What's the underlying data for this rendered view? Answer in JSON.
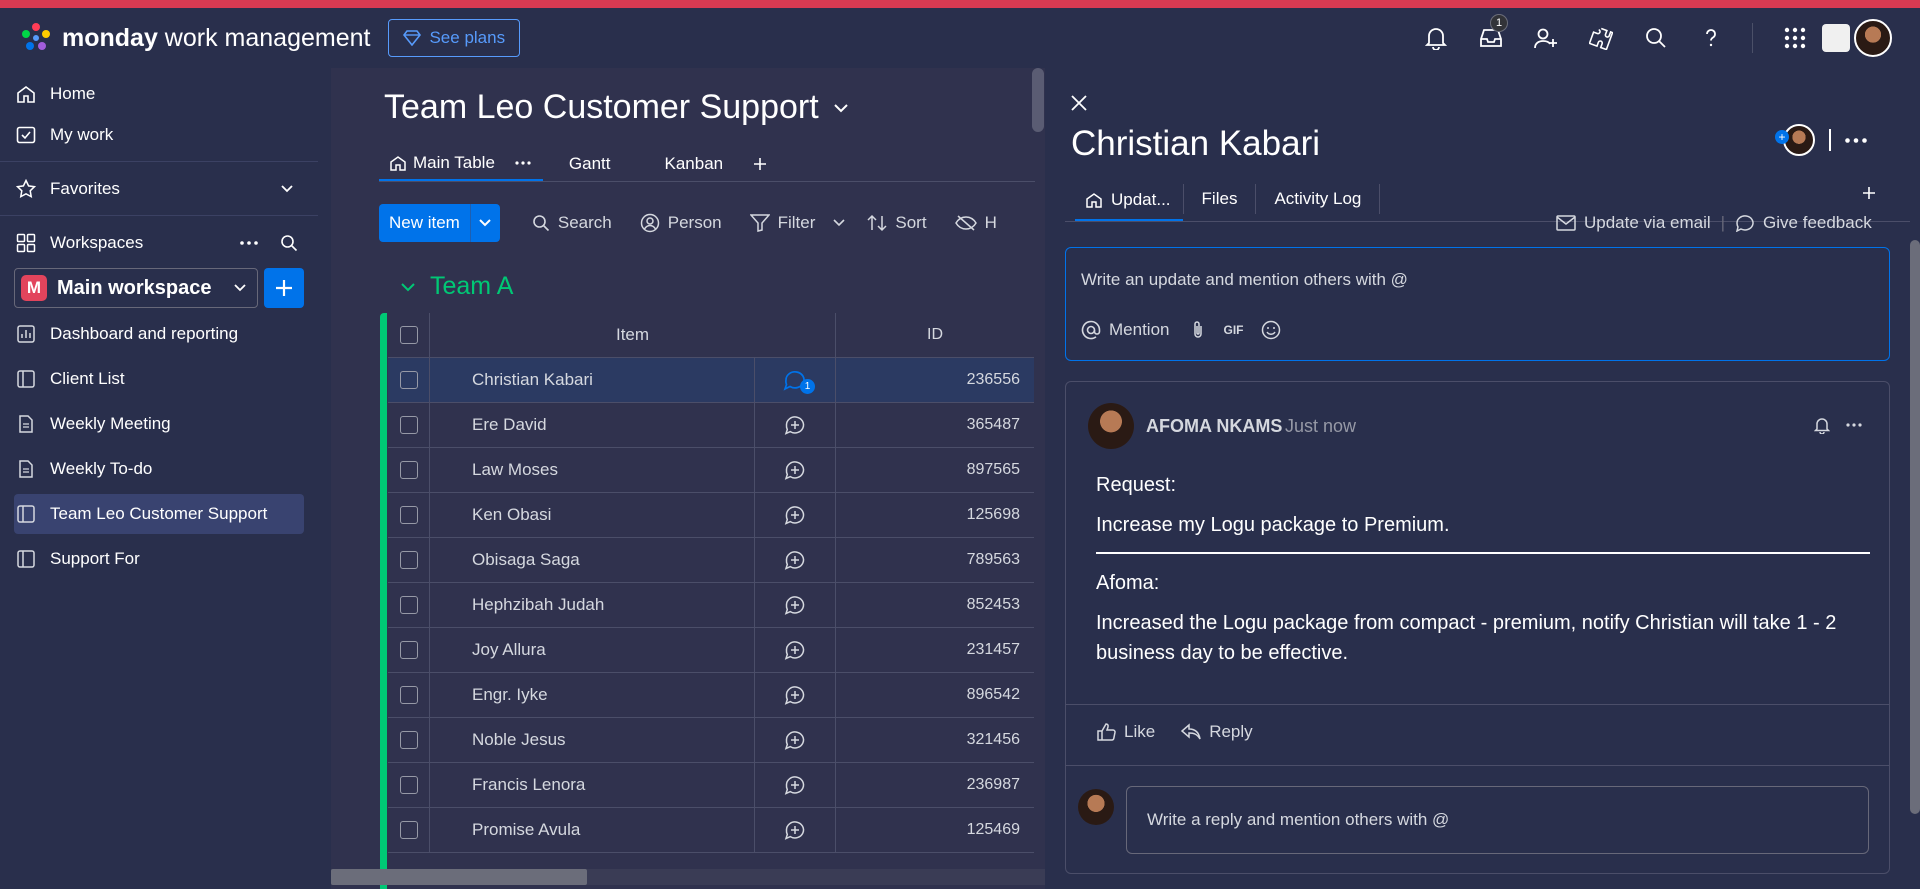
{
  "brand": {
    "bold": "monday",
    "rest": " work management"
  },
  "see_plans": "See plans",
  "notifications_badge": "1",
  "sidebar": {
    "home": "Home",
    "my_work": "My work",
    "favorites": "Favorites",
    "workspaces": "Workspaces",
    "workspace_badge": "M",
    "workspace_name": "Main workspace",
    "boards": [
      "Dashboard and reporting",
      "Client List",
      "Weekly Meeting",
      "Weekly To-do",
      "Team Leo Customer Support",
      "Support For"
    ]
  },
  "board": {
    "title": "Team Leo Customer Support",
    "tabs": [
      "Main Table",
      "Gantt",
      "Kanban"
    ],
    "toolbar": {
      "new_item": "New item",
      "search": "Search",
      "person": "Person",
      "filter": "Filter",
      "sort": "Sort",
      "hide": "H"
    },
    "group": "Team A",
    "columns": {
      "item": "Item",
      "id": "ID"
    },
    "rows": [
      {
        "name": "Christian Kabari",
        "id": "236556",
        "updates": "1"
      },
      {
        "name": "Ere David",
        "id": "365487"
      },
      {
        "name": "Law Moses",
        "id": "897565"
      },
      {
        "name": "Ken Obasi",
        "id": "125698"
      },
      {
        "name": "Obisaga Saga",
        "id": "789563"
      },
      {
        "name": "Hephzibah Judah",
        "id": "852453"
      },
      {
        "name": "Joy Allura",
        "id": "231457"
      },
      {
        "name": "Engr. Iyke",
        "id": "896542"
      },
      {
        "name": "Noble Jesus",
        "id": "321456"
      },
      {
        "name": "Francis Lenora",
        "id": "236987"
      },
      {
        "name": "Promise Avula",
        "id": "125469"
      }
    ]
  },
  "panel": {
    "title": "Christian Kabari",
    "tabs": [
      "Updat...",
      "Files",
      "Activity Log"
    ],
    "links": {
      "email": "Update via email",
      "feedback": "Give feedback"
    },
    "compose_placeholder": "Write an update and mention others with @",
    "compose_tools": {
      "mention": "Mention",
      "gif": "GIF"
    },
    "post": {
      "author": "AFOMA NKAMS",
      "time": "Just now",
      "request_label": "Request:",
      "request_text": "Increase my Logu package to Premium.",
      "reply_label": "Afoma:",
      "reply_line1": "Increased the Logu package from compact - premium, notify Christian will take  1 - 2",
      "reply_line2": "business day to be effective."
    },
    "actions": {
      "like": "Like",
      "reply": "Reply"
    },
    "reply_placeholder": "Write a reply and mention others with @"
  },
  "colors": {
    "accent": "#0073ea",
    "group": "#00c875",
    "topbar_stripe": "#d83a52"
  }
}
